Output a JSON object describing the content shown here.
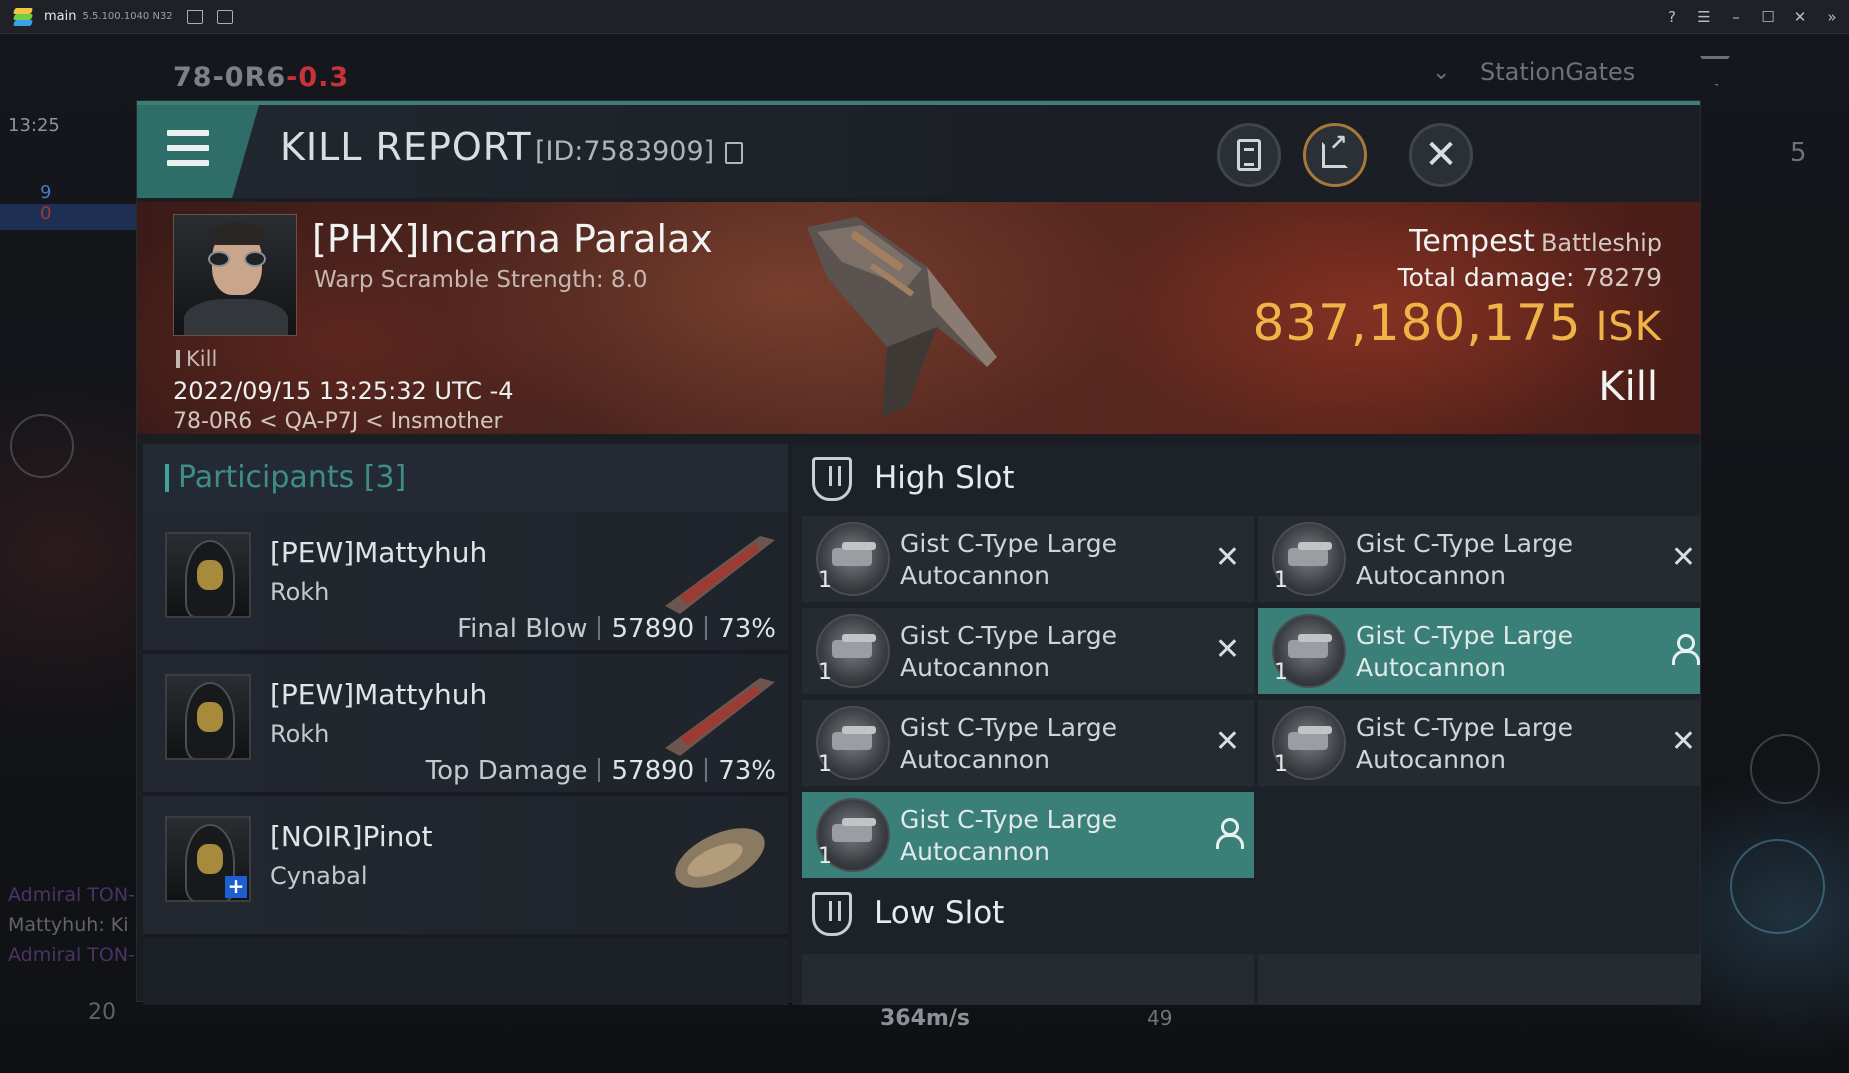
{
  "emulator": {
    "title": "main",
    "version": "5.5.100.1040 N32",
    "controls": [
      "?",
      "☰",
      "–",
      "☐",
      "✕",
      "»"
    ]
  },
  "hud": {
    "system": "78-0R6",
    "security": "-0.3",
    "time": "13:25",
    "overview_tab": "StationGates",
    "overview_count": "5",
    "speed": "364m/s",
    "right_value": "49",
    "left_count": "20",
    "minimap_blue": "9",
    "minimap_red": "0",
    "chat_lines": [
      {
        "name": "Admiral TON-",
        "text": ""
      },
      {
        "name": "Mattyhuh",
        "text": ": Ki"
      },
      {
        "name": "Admiral TON-",
        "text": ""
      }
    ]
  },
  "report": {
    "title": "KILL REPORT",
    "id": "[ID:7583909]",
    "buttons": {
      "log": "log-icon",
      "share": "share-icon",
      "close": "close-icon"
    },
    "victim": {
      "name": "[PHX]Incarna Paralax",
      "warp": "Warp Scramble Strength: 8.0",
      "tag": "Kill",
      "date": "2022/09/15 13:25:32 UTC -4",
      "location": "78-0R6 < QA-P7J < Insmother",
      "ship": "Tempest",
      "ship_class": "Battleship",
      "total_damage_label": "Total damage:",
      "total_damage": "78279",
      "isk_value": "837,180,175",
      "isk_unit": "ISK",
      "result": "Kill"
    },
    "participants": {
      "title": "Participants [3]",
      "rows": [
        {
          "name": "[PEW]Mattyhuh",
          "ship": "Rokh",
          "label": "Final Blow",
          "damage": "57890",
          "percent": "73%"
        },
        {
          "name": "[PEW]Mattyhuh",
          "ship": "Rokh",
          "label": "Top Damage",
          "damage": "57890",
          "percent": "73%"
        },
        {
          "name": "[NOIR]Pinot",
          "ship": "Cynabal",
          "label": "",
          "damage": "",
          "percent": ""
        }
      ]
    },
    "high_slot": {
      "title": "High Slot",
      "modules": [
        {
          "name": "Gist C-Type Large Autocannon",
          "qty": "1",
          "status": "destroyed"
        },
        {
          "name": "Gist C-Type Large Autocannon",
          "qty": "1",
          "status": "destroyed"
        },
        {
          "name": "Gist C-Type Large Autocannon",
          "qty": "1",
          "status": "destroyed"
        },
        {
          "name": "Gist C-Type Large Autocannon",
          "qty": "1",
          "status": "dropped"
        },
        {
          "name": "Gist C-Type Large Autocannon",
          "qty": "1",
          "status": "destroyed"
        },
        {
          "name": "Gist C-Type Large Autocannon",
          "qty": "1",
          "status": "destroyed"
        },
        {
          "name": "Gist C-Type Large Autocannon",
          "qty": "1",
          "status": "dropped"
        }
      ]
    },
    "low_slot": {
      "title": "Low Slot"
    }
  },
  "colors": {
    "accent": "#3a7f78",
    "isk": "#f0b347",
    "security": "#c6343a"
  }
}
